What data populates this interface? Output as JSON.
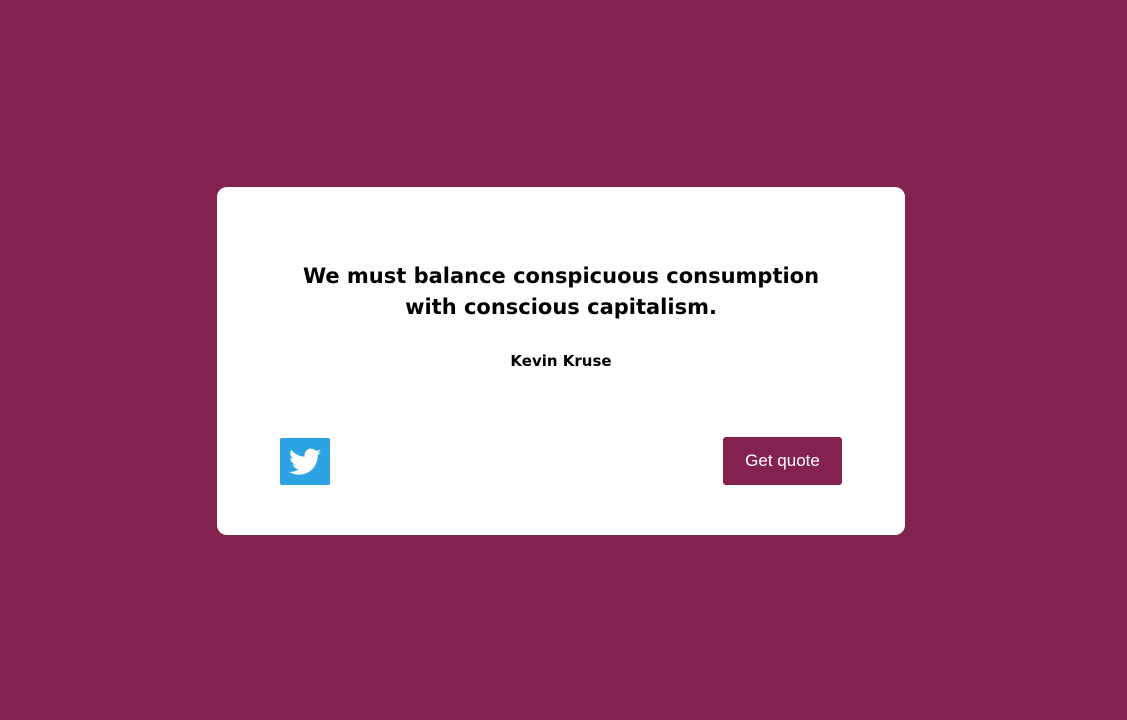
{
  "colors": {
    "background": "#83224e",
    "card": "#ffffff",
    "twitter_blue": "#2ea3e3",
    "button": "#83224e",
    "text": "#000000"
  },
  "quote": {
    "text": "We must balance conspicuous consumption with conscious capitalism.",
    "author": "Kevin Kruse"
  },
  "actions": {
    "tweet_icon": "twitter-bird-icon",
    "new_quote_label": "Get quote"
  }
}
